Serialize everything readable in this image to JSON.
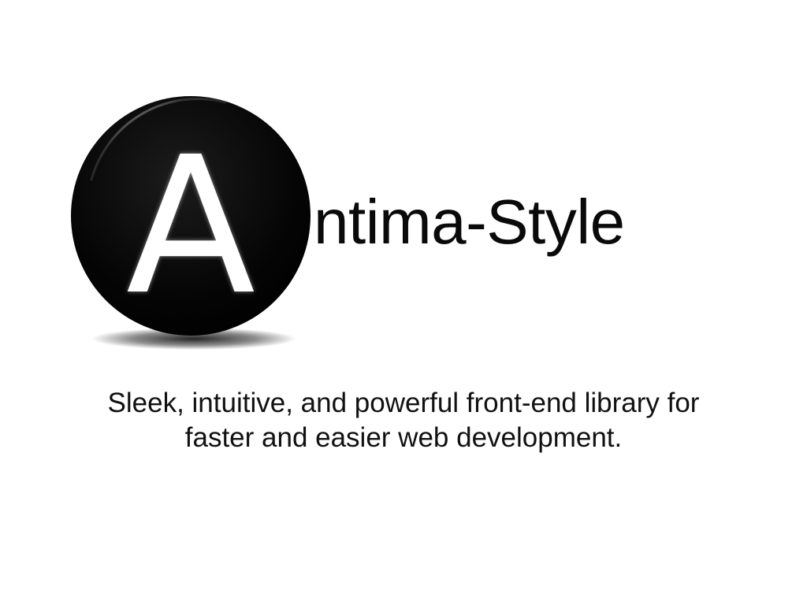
{
  "logo": {
    "letter": "A",
    "badge_color": "#000000",
    "letter_color": "#ffffff"
  },
  "title": {
    "text": "ntima-Style"
  },
  "tagline": {
    "line1": "Sleek, intuitive, and powerful front-end library for",
    "line2": "faster and easier web development."
  }
}
